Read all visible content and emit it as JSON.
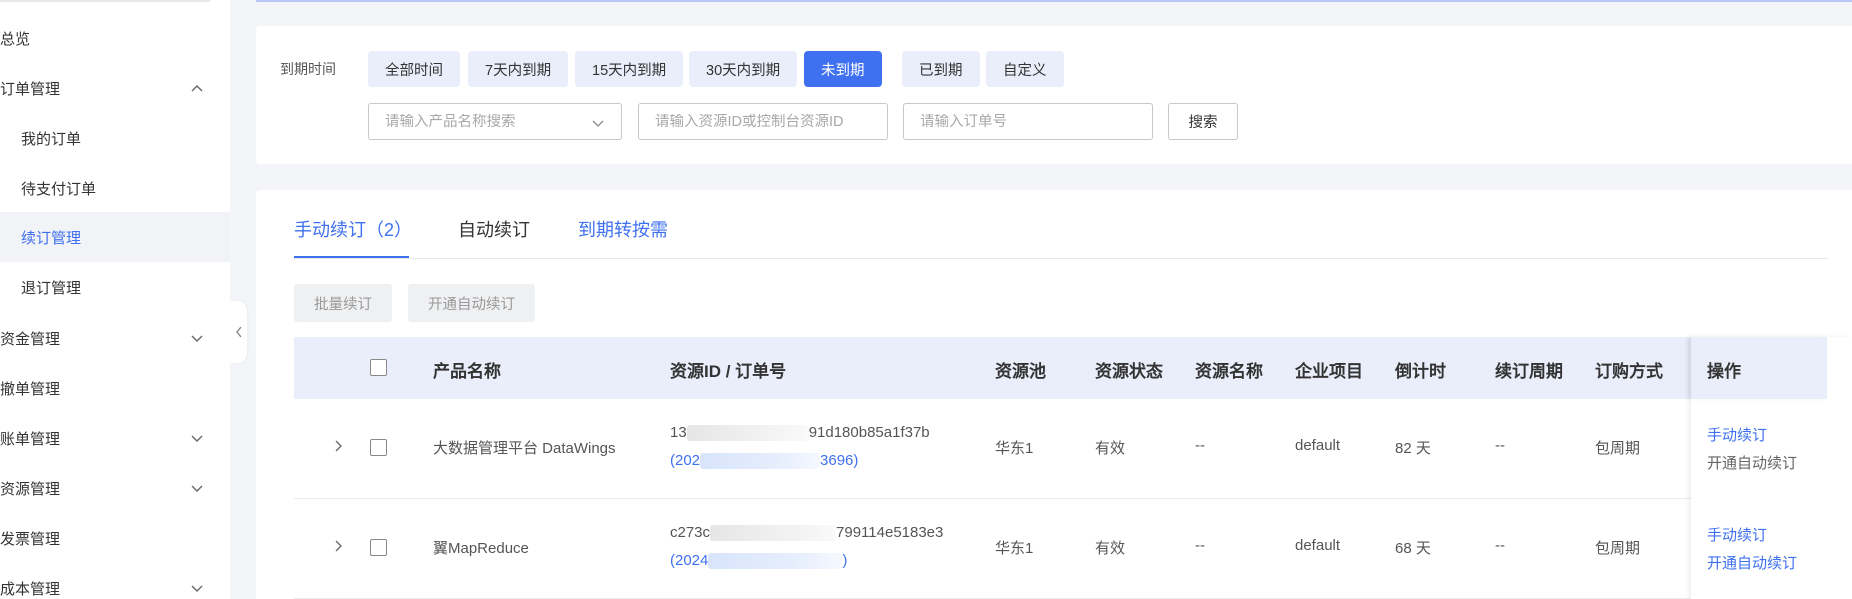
{
  "sidebar": {
    "items": [
      {
        "label": "总览"
      },
      {
        "label": "订单管理"
      },
      {
        "label": "我的订单"
      },
      {
        "label": "待支付订单"
      },
      {
        "label": "续订管理"
      },
      {
        "label": "退订管理"
      },
      {
        "label": "资金管理"
      },
      {
        "label": "撤单管理"
      },
      {
        "label": "账单管理"
      },
      {
        "label": "资源管理"
      },
      {
        "label": "发票管理"
      },
      {
        "label": "成本管理"
      }
    ]
  },
  "filter": {
    "label": "到期时间",
    "chips": [
      "全部时间",
      "7天内到期",
      "15天内到期",
      "30天内到期",
      "未到期",
      "已到期",
      "自定义"
    ],
    "active_chip": "未到期",
    "product_placeholder": "请输入产品名称搜索",
    "resource_placeholder": "请输入资源ID或控制台资源ID",
    "order_placeholder": "请输入订单号",
    "search_label": "搜索"
  },
  "tabs": [
    "手动续订（2）",
    "自动续订",
    "到期转按需"
  ],
  "actions": {
    "batch_renew": "批量续订",
    "enable_auto": "开通自动续订"
  },
  "table": {
    "headers": [
      "产品名称",
      "资源ID / 订单号",
      "资源池",
      "资源状态",
      "资源名称",
      "企业项目",
      "倒计时",
      "续订周期",
      "订购方式",
      "操作"
    ],
    "rows": [
      {
        "product": "大数据管理平台 DataWings",
        "id_prefix": "13",
        "id_suffix": "91d180b85a1f37b",
        "order_prefix": "(202",
        "order_suffix": "3696)",
        "pool": "华东1",
        "status": "有效",
        "name": "--",
        "project": "default",
        "countdown": "82 天",
        "period": "--",
        "mode": "包周期",
        "op_manual": "手动续订",
        "op_auto": "开通自动续订"
      },
      {
        "product": "翼MapReduce",
        "id_prefix": "c273c",
        "id_suffix": "799114e5183e3",
        "order_prefix": "(2024",
        "order_suffix": ")",
        "pool": "华东1",
        "status": "有效",
        "name": "--",
        "project": "default",
        "countdown": "68 天",
        "period": "--",
        "mode": "包周期",
        "op_manual": "手动续订",
        "op_auto": "开通自动续订"
      }
    ]
  },
  "colors": {
    "accent": "#3f70f0",
    "chip_bg": "#eaeefa",
    "header_bg": "#eaeefa"
  }
}
